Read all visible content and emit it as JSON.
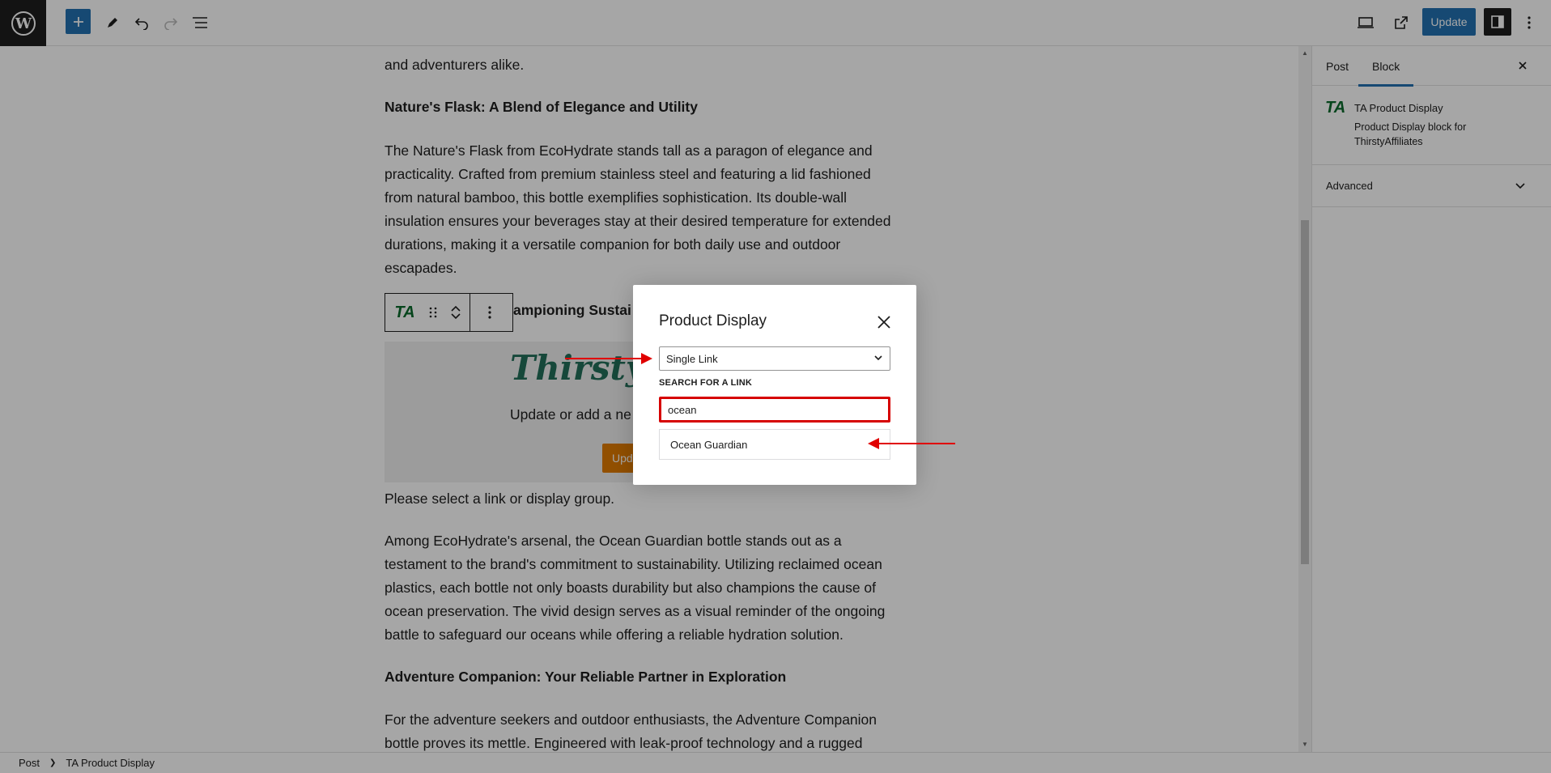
{
  "toolbar": {
    "update_label": "Update"
  },
  "content": {
    "para0_tail": "and adventurers alike.",
    "heading1": "Nature's Flask: A Blend of Elegance and Utility",
    "para1_lines": [
      "The Nature's Flask from EcoHydrate stands tall as a paragon of elegance and",
      "practicality. Crafted from premium stainless steel and featuring a lid fashioned",
      "from natural bamboo, this bottle exemplifies sophistication. Its double-wall",
      "insulation ensures your beverages stay at their desired temperature for extended",
      "durations, making it a versatile companion for both daily use and outdoor",
      "escapades."
    ],
    "heading2_partial": "ampioning Sustai",
    "placeholder": {
      "logo_text": "ThirstyA",
      "desc": "Update or add a ne",
      "button": "Upda"
    },
    "select_message": "Please select a link or display group.",
    "para2_lines": [
      "Among EcoHydrate's arsenal, the Ocean Guardian bottle stands out as a",
      "testament to the brand's commitment to sustainability. Utilizing reclaimed ocean",
      "plastics, each bottle not only boasts durability but also champions the cause of",
      "ocean preservation. The vivid design serves as a visual reminder of the ongoing",
      "battle to safeguard our oceans while offering a reliable hydration solution."
    ],
    "heading3": "Adventure Companion: Your Reliable Partner in Exploration",
    "para3_lines": [
      "For the adventure seekers and outdoor enthusiasts, the Adventure Companion",
      "bottle proves its mettle. Engineered with leak-proof technology and a rugged"
    ]
  },
  "block_toolbar": {
    "logo": "TA"
  },
  "sidebar": {
    "tabs": [
      "Post",
      "Block"
    ],
    "active_tab": "Block",
    "block_logo": "TA",
    "block_title": "TA Product Display",
    "block_desc": "Product Display block for ThirstyAffiliates",
    "advanced_label": "Advanced"
  },
  "footer": {
    "crumbs": [
      "Post",
      "TA Product Display"
    ]
  },
  "modal": {
    "title": "Product Display",
    "select_value": "Single Link",
    "search_label": "SEARCH FOR A LINK",
    "search_value": "ocean",
    "result": "Ocean Guardian"
  },
  "colors": {
    "accent": "#2271b1",
    "highlight": "#d60000",
    "ta_green": "#236f5a",
    "ta_orange": "#e07b00"
  }
}
